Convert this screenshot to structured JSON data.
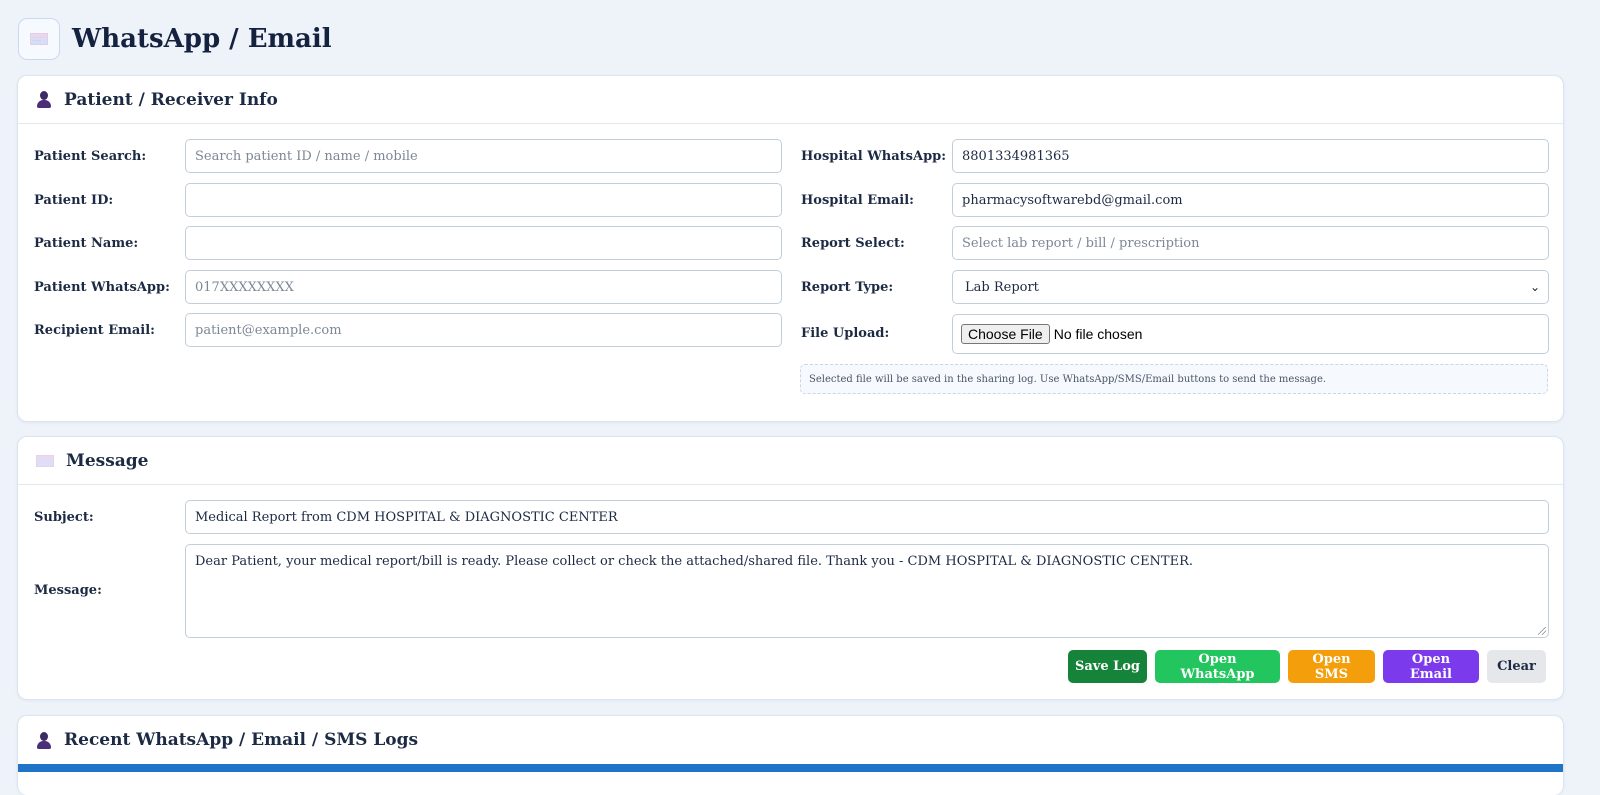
{
  "page": {
    "title": "WhatsApp / Email"
  },
  "patient_card": {
    "title": "Patient / Receiver Info",
    "left_fields": [
      {
        "label": "Patient Search:",
        "value": "",
        "placeholder": "Search patient ID / name / mobile"
      },
      {
        "label": "Patient ID:",
        "value": "",
        "placeholder": ""
      },
      {
        "label": "Patient Name:",
        "value": "",
        "placeholder": ""
      },
      {
        "label": "Patient WhatsApp:",
        "value": "",
        "placeholder": "017XXXXXXXX"
      },
      {
        "label": "Recipient Email:",
        "value": "",
        "placeholder": "patient@example.com"
      }
    ],
    "right_fields": [
      {
        "label": "Hospital WhatsApp:",
        "value": "8801334981365",
        "placeholder": ""
      },
      {
        "label": "Hospital Email:",
        "value": "pharmacysoftwarebd@gmail.com",
        "placeholder": ""
      },
      {
        "label": "Report Select:",
        "value": "",
        "placeholder": "Select lab report / bill / prescription"
      },
      {
        "label": "Report Type:",
        "value": "Lab Report"
      },
      {
        "label": "File Upload:",
        "button": "Choose File",
        "status": "No file chosen"
      }
    ],
    "hint": "Selected file will be saved in the sharing log. Use WhatsApp/SMS/Email buttons to send the message."
  },
  "message_card": {
    "title": "Message",
    "subject_label": "Subject:",
    "subject_value": "Medical Report from CDM HOSPITAL & DIAGNOSTIC CENTER",
    "message_label": "Message:",
    "message_value": "Dear Patient, your medical report/bill is ready. Please collect or check the attached/shared file. Thank you - CDM HOSPITAL & DIAGNOSTIC CENTER.",
    "buttons": {
      "save_log": "Save Log",
      "open_whatsapp": "Open WhatsApp",
      "open_sms": "Open SMS",
      "open_email": "Open Email",
      "clear": "Clear"
    }
  },
  "logs_card": {
    "title": "Recent WhatsApp / Email / SMS Logs"
  },
  "colors": {
    "save_log": "#16833a",
    "open_whatsapp": "#22c55e",
    "open_sms": "#f59e0b",
    "open_email": "#7c3aed",
    "clear": "#e5e7eb",
    "logs_bar": "#1f74c7"
  }
}
